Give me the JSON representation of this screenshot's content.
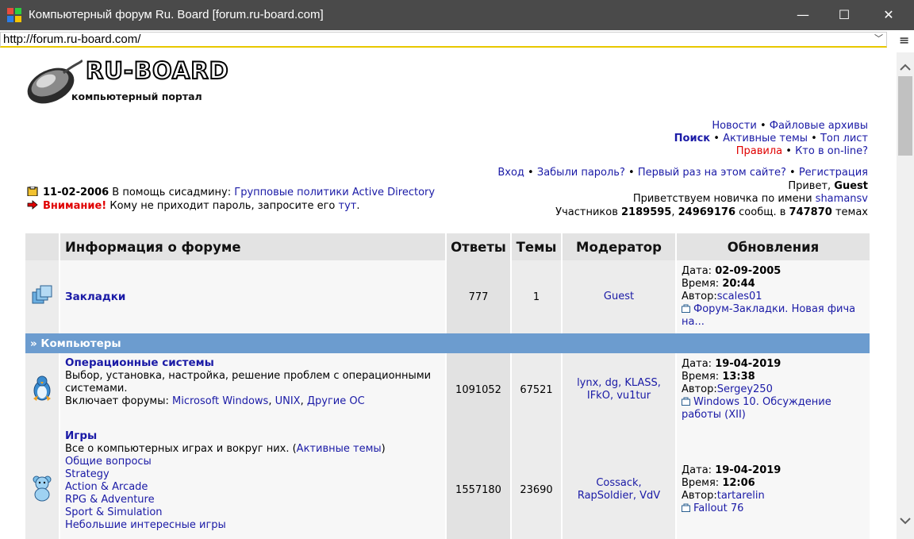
{
  "window": {
    "title": "Компьютерный форум Ru. Board [forum.ru-board.com]",
    "minimize": "—",
    "maximize": "☐",
    "close": "✕"
  },
  "address": {
    "url": "http://forum.ru-board.com/",
    "dropdown": "﹀",
    "menu": "≡"
  },
  "logo": {
    "text": "RU-BOARD",
    "subtitle": "компьютерный портал"
  },
  "nav": {
    "news": "Новости",
    "files": "Файловые архивы",
    "search": "Поиск",
    "active": "Активные темы",
    "top": "Топ лист",
    "rules": "Правила",
    "online": "Кто в on-line?",
    "bullet": "•"
  },
  "user": {
    "login": "Вход",
    "forgot": "Забыли пароль?",
    "first_time": "Первый раз на этом сайте?",
    "register": "Регистрация",
    "greeting": "Привет,",
    "guest": "Guest",
    "welcome_new": "Приветствуем новичка по имени",
    "newbie": "shamansv",
    "members_label": "Участников",
    "members": "2189595",
    "posts": "24969176",
    "posts_label": "сообщ. в",
    "topics": "747870",
    "topics_label": "темах"
  },
  "news": {
    "date": "11-02-2006",
    "text": "В помощь сисадмину:",
    "link": "Групповые политики Active Directory",
    "warn_label": "Внимание!",
    "warn_text": "Кому не приходит пароль, запросите его",
    "warn_link": "тут",
    "warn_end": "."
  },
  "table": {
    "headers": {
      "info": "Информация о форуме",
      "replies": "Ответы",
      "topics": "Темы",
      "moderator": "Модератор",
      "updates": "Обновления"
    },
    "labels": {
      "date": "Дата:",
      "time": "Время:",
      "author": "Автор:",
      "includes": "Включает форумы:"
    },
    "bookmarks": {
      "name": "Закладки",
      "replies": "777",
      "topics": "1",
      "moderator": "Guest",
      "date": "02-09-2005",
      "time": "20:44",
      "author": "scales01",
      "post": "Форум-Закладки. Новая фича на..."
    },
    "category": "» Компьютеры",
    "os": {
      "name": "Операционные системы",
      "desc": "Выбор, установка, настройка, решение проблем с операционными системами.",
      "sub1": "Microsoft Windows",
      "sub2": "UNIX",
      "sub3": "Другие ОС",
      "replies": "1091052",
      "topics": "67521",
      "mods1": "lynx, dg, KLASS,",
      "mods2": "IFkO, vu1tur",
      "date": "19-04-2019",
      "time": "13:38",
      "author": "Sergey250",
      "post": "Windows 10. Обсуждение работы (XII)"
    },
    "games": {
      "name": "Игры",
      "desc": "Все о компьютерных играх и вокруг них. (",
      "active": "Активные темы",
      "desc_end": ")",
      "sub1": "Общие вопросы",
      "sub2": "Strategy",
      "sub3": "Action & Arcade",
      "sub4": "RPG & Adventure",
      "sub5": "Sport & Simulation",
      "sub6": "Небольшие интересные игры",
      "replies": "1557180",
      "topics": "23690",
      "mods1": "Cossack,",
      "mods2": "RapSoldier, VdV",
      "date": "19-04-2019",
      "time": "12:06",
      "author": "tartarelin",
      "post": "Fallout 76"
    }
  },
  "colors": {
    "link": "#1a1aa6",
    "category_bar": "#6c9ccf",
    "warning": "#e00000",
    "titlebar": "#4a4a4a"
  }
}
